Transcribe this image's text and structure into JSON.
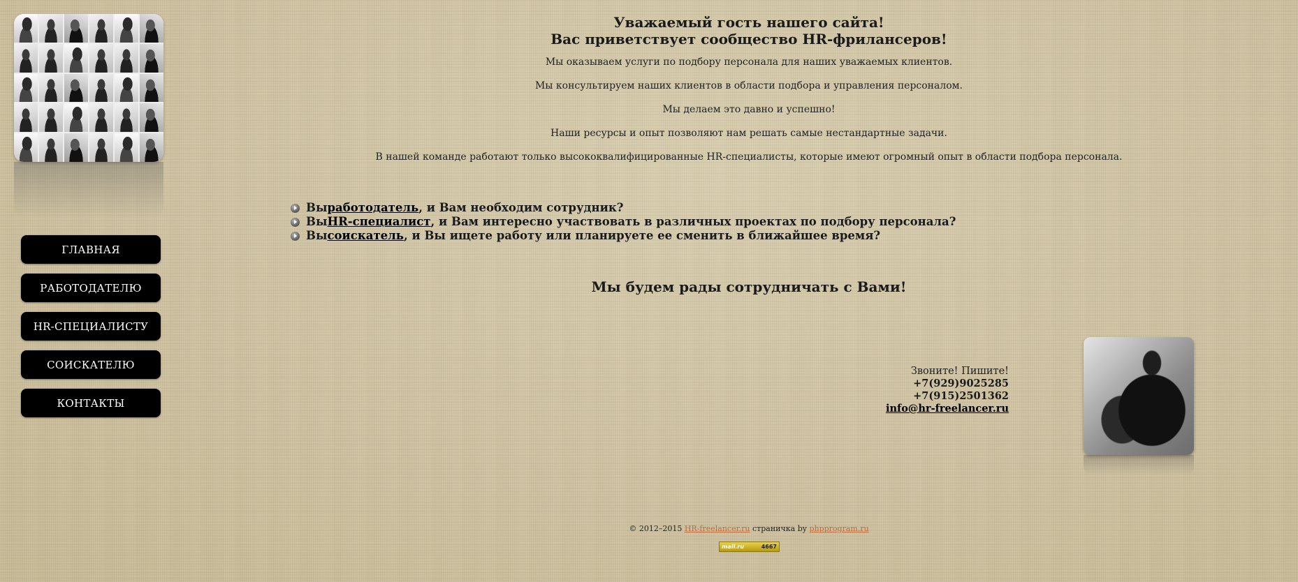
{
  "nav": {
    "items": [
      {
        "label": "ГЛАВНАЯ"
      },
      {
        "label": "РАБОТОДАТЕЛЮ"
      },
      {
        "label": "HR-СПЕЦИАЛИСТУ"
      },
      {
        "label": "СОИСКАТЕЛЮ"
      },
      {
        "label": "КОНТАКТЫ"
      }
    ]
  },
  "welcome": {
    "line1": "Уважаемый гость нашего сайта!",
    "line2": "Вас приветствует сообщество HR-фрилансеров!"
  },
  "intro": [
    "Мы оказываем услуги по подбору персонала для наших уважаемых клиентов.",
    "Мы консультируем наших клиентов в области подбора и управления персоналом.",
    "Мы делаем это давно и успешно!",
    "Наши ресурсы и опыт позволяют нам решать самые нестандартные задачи.",
    "В нашей команде работают только высококвалифицированные HR-специалисты, которые имеют огромный опыт в области подбора персонала."
  ],
  "questions": [
    {
      "prefix": "Вы ",
      "link": "работодатель",
      "suffix": ", и Вам необходим сотрудник?"
    },
    {
      "prefix": "Вы ",
      "link": "HR-специалист",
      "suffix": ", и Вам интересно участвовать в различных проектах по подбору персонала?"
    },
    {
      "prefix": "Вы ",
      "link": "соискатель",
      "suffix": ", и Вы ищете работу или планируете ее сменить в ближайшее время?"
    }
  ],
  "closing": "Мы будем рады сотрудничать с Вами!",
  "contacts": {
    "call": "Звоните! Пишите!",
    "phone1": "+7(929)9025285",
    "phone2": "+7(915)2501362",
    "email": "info@hr-freelancer.ru"
  },
  "footer": {
    "copyright": "© 2012–2015 ",
    "site_link": "HR-freelancer.ru",
    "by_text": " страничка by ",
    "author_link": "phpprogram.ru",
    "counter_logo": "mail.ru",
    "counter_value": "4667"
  },
  "icons": {
    "bullet": "arrow-bullet-icon",
    "photo_grid": "people-photo-grid",
    "phone_lady": "phone-lady-photo"
  }
}
